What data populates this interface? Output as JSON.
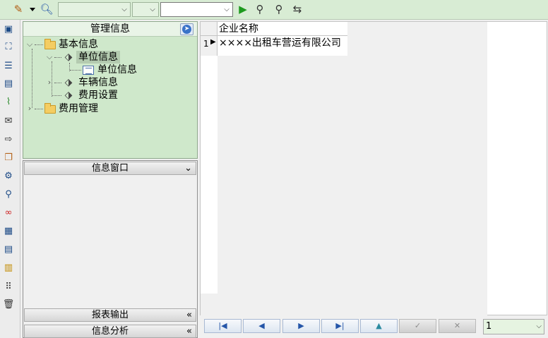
{
  "toolbar": {
    "combo1_value": "",
    "combo2_value": "",
    "search_value": "",
    "icons": [
      "pencil-icon",
      "dropdown-arrow-icon",
      "preview-icon",
      "run-icon",
      "find-icon",
      "find-next-icon",
      "refresh-icon"
    ]
  },
  "left_strip": {
    "icons": [
      "window-icon",
      "tree-icon",
      "list-icon",
      "document-icon",
      "chart-icon",
      "mail-icon",
      "export-icon",
      "copy-icon",
      "settings-icon",
      "search-person-icon",
      "link-icon",
      "grid-report-icon",
      "doc-settings-icon",
      "sheet-icon",
      "grid-dots-icon",
      "trash-icon"
    ]
  },
  "management": {
    "title": "管理信息",
    "tree": {
      "basic_info": "基本信息",
      "unit_info_group": "单位信息",
      "unit_info_item": "单位信息",
      "vehicle_info": "车辆信息",
      "fee_settings": "费用设置",
      "fee_management": "费用管理"
    }
  },
  "info_window": {
    "title": "信息窗口",
    "report_output": "报表输出",
    "info_analysis": "信息分析"
  },
  "grid": {
    "columns": [
      "企业名称"
    ],
    "rows": [
      {
        "index": "1",
        "cells": [
          "××××出租车营运有限公司"
        ]
      }
    ]
  },
  "navigator": {
    "first": "|◀",
    "prior": "◀",
    "next": "▶",
    "last": "▶|",
    "insert": "▲",
    "post": "✓",
    "cancel": "✕",
    "page_value": "1"
  },
  "colors": {
    "toolbar_bg": "#d8ecd4",
    "tree_bg": "#cfe8cb",
    "accent_blue": "#2455a8"
  }
}
